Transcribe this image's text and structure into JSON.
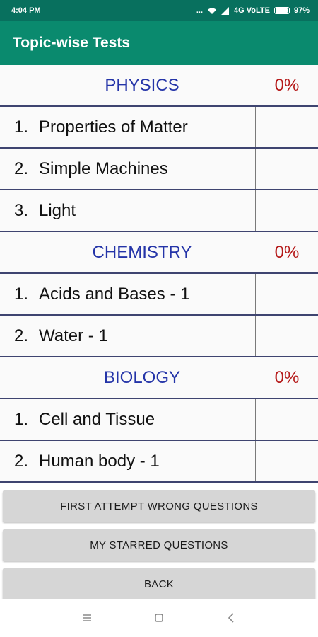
{
  "status": {
    "time": "4:04 PM",
    "icons": [
      "dots-icon",
      "wifi-icon",
      "signal-icon",
      "network-label",
      "battery-icon"
    ],
    "dots": "...",
    "network": "4G VoLTE",
    "battery": "97%"
  },
  "app_bar": {
    "title": "Topic-wise Tests"
  },
  "sections": [
    {
      "title": "PHYSICS",
      "percent": "0%",
      "topics": [
        {
          "num": "1.",
          "name": "Properties of Matter"
        },
        {
          "num": "2.",
          "name": "Simple Machines"
        },
        {
          "num": "3.",
          "name": "Light"
        }
      ]
    },
    {
      "title": "CHEMISTRY",
      "percent": "0%",
      "topics": [
        {
          "num": "1.",
          "name": "Acids and Bases - 1"
        },
        {
          "num": "2.",
          "name": "Water - 1"
        }
      ]
    },
    {
      "title": "BIOLOGY",
      "percent": "0%",
      "topics": [
        {
          "num": "1.",
          "name": "Cell and Tissue"
        },
        {
          "num": "2.",
          "name": "Human body - 1"
        }
      ]
    }
  ],
  "buttons": {
    "first_attempt": "FIRST ATTEMPT WRONG QUESTIONS",
    "starred": "MY STARRED QUESTIONS",
    "back": "BACK"
  },
  "colors": {
    "status_bar": "#08705e",
    "app_bar": "#0a8a6e",
    "section_title": "#2434a8",
    "percent": "#b51a1a"
  }
}
